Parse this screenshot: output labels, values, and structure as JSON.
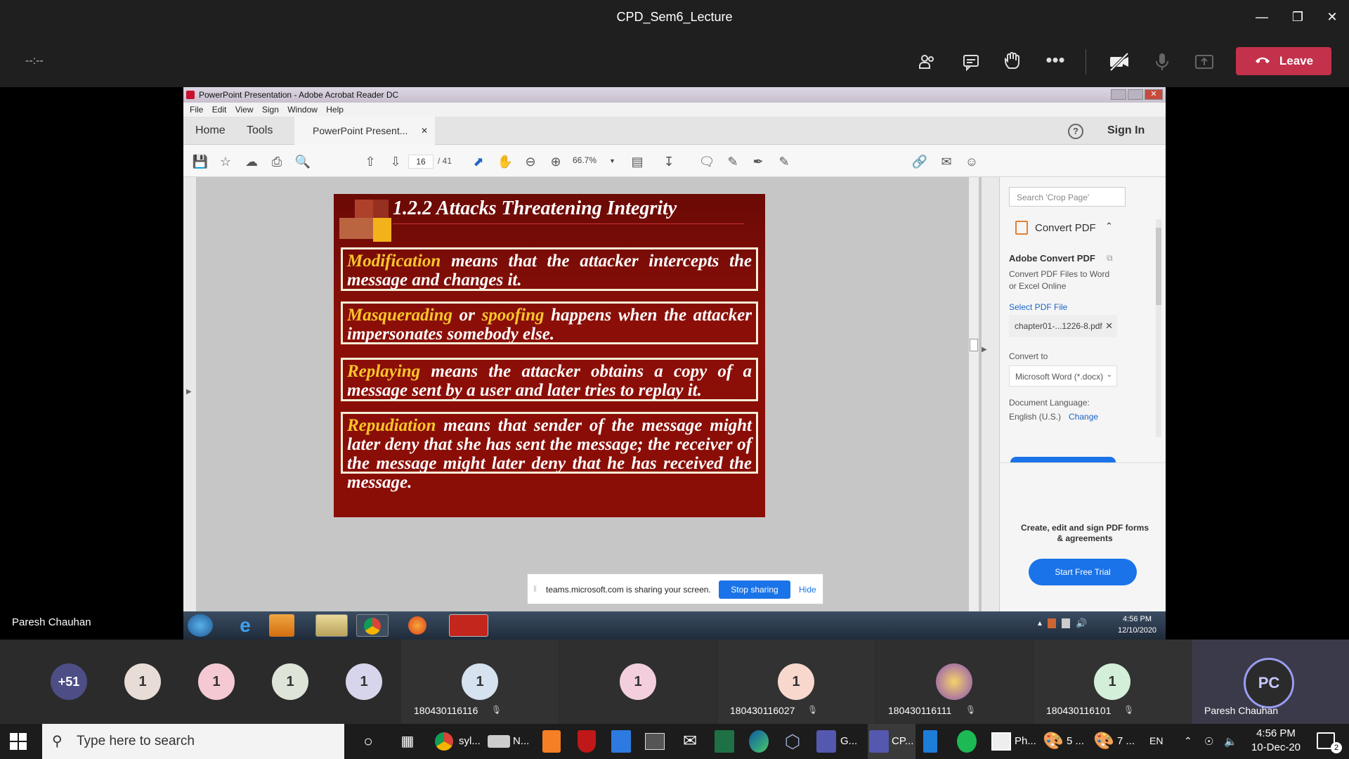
{
  "window_title": "CPD_Sem6_Lecture",
  "timer": "--:--",
  "leave_label": "Leave",
  "presenter_name": "Paresh Chauhan",
  "acrobat": {
    "title": "PowerPoint Presentation - Adobe Acrobat Reader DC",
    "menu": [
      "File",
      "Edit",
      "View",
      "Sign",
      "Window",
      "Help"
    ],
    "tab_home": "Home",
    "tab_tools": "Tools",
    "tab_doc": "PowerPoint Present...",
    "sign_in": "Sign In",
    "page_current": "16",
    "page_total": "/ 41",
    "zoom": "66.7%"
  },
  "slide": {
    "title": "1.2.2  Attacks Threatening Integrity",
    "b1_hl": "Modification",
    "b1_text": " means that the attacker intercepts the message and changes it.",
    "b2_hl1": "Masquerading",
    "b2_mid": " or ",
    "b2_hl2": "spoofing",
    "b2_text": " happens when the attacker impersonates somebody else.",
    "b3_hl": "Replaying",
    "b3_text": " means the attacker obtains a copy of a message sent by a user and later tries to replay it.",
    "b4_hl": "Repudiation",
    "b4_text": " means that  sender of the message might later deny that she has sent the message; the receiver of the message might later deny that he has received the message."
  },
  "panel": {
    "search_placeholder": "Search 'Crop Page'",
    "convert_header": "Convert PDF",
    "adobe_convert": "Adobe Convert PDF",
    "desc": "Convert PDF Files to Word or Excel Online",
    "select_file": "Select PDF File",
    "file_name": "chapter01-...1226-8.pdf",
    "convert_to": "Convert to",
    "format": "Microsoft Word (*.docx)",
    "doc_lang": "Document Language:",
    "lang": "English (U.S.)",
    "change": "Change",
    "promo": "Create, edit and sign PDF forms & agreements",
    "trial": "Start Free Trial"
  },
  "share_banner": {
    "text": "teams.microsoft.com is sharing your screen.",
    "stop": "Stop sharing",
    "hide": "Hide"
  },
  "w7_clock": {
    "time": "4:56 PM",
    "date": "12/10/2020"
  },
  "participants": {
    "overflow": "+51",
    "avatars": [
      {
        "label": "1",
        "color": "#e8ddd6"
      },
      {
        "label": "1",
        "color": "#f5c9d3"
      },
      {
        "label": "1",
        "color": "#dfe4d9"
      },
      {
        "label": "1",
        "color": "#d6d5eb"
      },
      {
        "label": "1",
        "color": "#d6e2ef",
        "name": "180430116116"
      },
      {
        "label": "1",
        "color": "#f3cfdd"
      },
      {
        "label": "1",
        "color": "#f8d7cc",
        "name": "180430116027"
      },
      {
        "label": "",
        "color": "#e0b75a",
        "name": "180430116111"
      },
      {
        "label": "1",
        "color": "#d3efd9",
        "name": "180430116101"
      },
      {
        "label": "PC",
        "color": "#2b2b2b",
        "name": "Paresh Chauhan"
      }
    ]
  },
  "taskbar": {
    "search_placeholder": "Type here to search",
    "apps": [
      "syl...",
      "N...",
      "G...",
      "CP...",
      "Ph...",
      "5 ...",
      "7 ..."
    ],
    "lang": "EN",
    "time": "4:56 PM",
    "date": "10-Dec-20",
    "notif": "2"
  }
}
